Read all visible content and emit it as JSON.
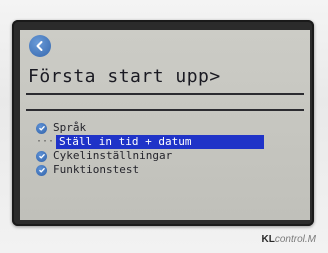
{
  "screen": {
    "title": "Första start upp>",
    "back_icon": "back-arrow-icon"
  },
  "menu": {
    "items": [
      {
        "label": "Språk",
        "icon": "check-icon",
        "selected": false
      },
      {
        "label": "Ställ in tid + datum",
        "icon": "dots-icon",
        "selected": true
      },
      {
        "label": "Cykelinställningar",
        "icon": "check-icon",
        "selected": false
      },
      {
        "label": "Funktionstest",
        "icon": "check-icon",
        "selected": false
      }
    ]
  },
  "brand": {
    "bold": "KL",
    "light": "control.M"
  },
  "colors": {
    "highlight": "#1f33c8",
    "check": "#3567ad",
    "lcd_bg": "#c6c6c0",
    "text": "#1a1a22"
  }
}
